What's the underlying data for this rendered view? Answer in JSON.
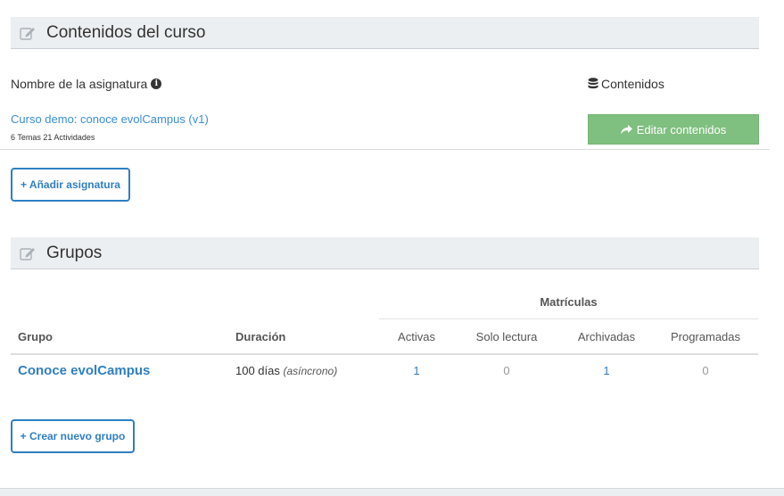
{
  "content_section": {
    "title": "Contenidos del curso",
    "subject_label": "Nombre de la asignatura",
    "contents_label": "Contenidos",
    "course_link": "Curso demo: conoce evolCampus (v1)",
    "course_meta": "6 Temas 21 Actividades",
    "edit_button": "Editar contenidos",
    "add_subject_button": "+ Añadir asignatura"
  },
  "groups_section": {
    "title": "Grupos",
    "enrollments_header": "Matrículas",
    "columns": {
      "group": "Grupo",
      "duration": "Duración",
      "active": "Activas",
      "read_only": "Solo lectura",
      "archived": "Archivadas",
      "scheduled": "Programadas"
    },
    "rows": [
      {
        "group": "Conoce evolCampus",
        "duration": "100 días",
        "duration_mode": "(asíncrono)",
        "active": "1",
        "read_only": "0",
        "archived": "1",
        "scheduled": "0"
      }
    ],
    "new_group_button": "+ Crear nuevo grupo"
  },
  "colors": {
    "accent": "#2f7fc1",
    "link": "#3a8fd6",
    "success_button": "#7fbf7f",
    "header_band": "#eceff1"
  },
  "icons": {
    "section_header": "edit-icon",
    "subject_info": "info-icon",
    "contents": "database-icon",
    "edit_button": "share-icon"
  }
}
